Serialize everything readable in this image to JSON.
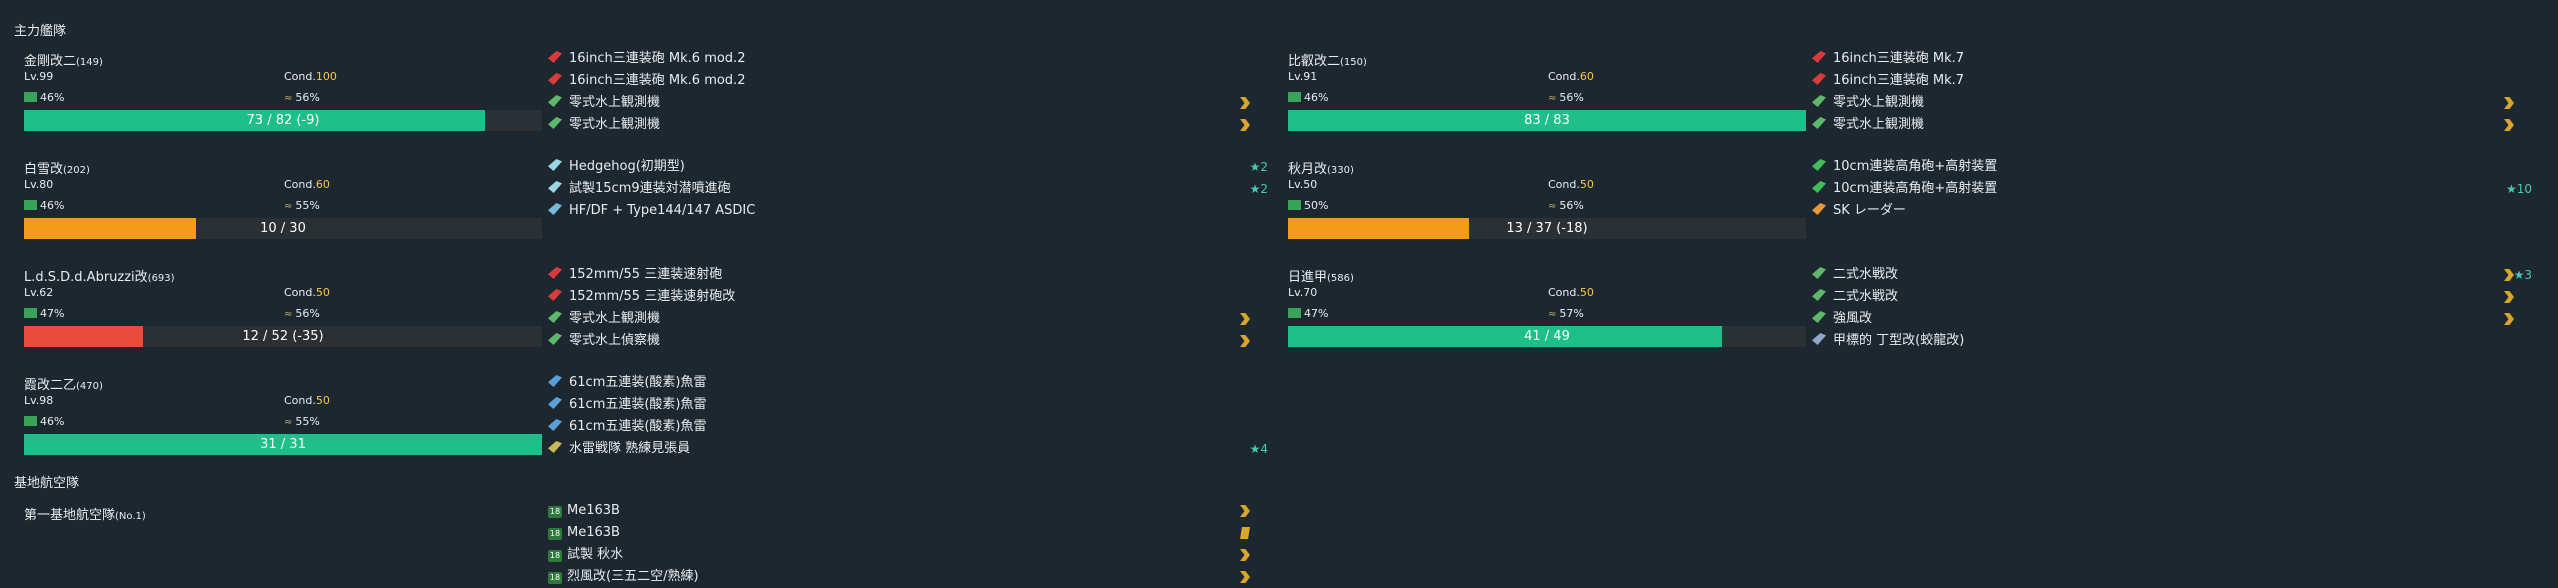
{
  "fleet_title": "主力艦隊",
  "air_title": "基地航空隊",
  "cond_label": "Cond.",
  "ships": [
    {
      "name": "金剛改二",
      "id": "(149)",
      "lv": "Lv.99",
      "cond": "100",
      "fuel": "46%",
      "ammo": "56%",
      "hp": "73 / 82 (-9)",
      "hp_frac": 0.89,
      "hp_color": "#1fbf8a",
      "equips": [
        {
          "name": "16inch三連装砲 Mk.6 mod.2",
          "icon": "main-gun-icon",
          "color": "#d83a3a",
          "prof": false,
          "star": ""
        },
        {
          "name": "16inch三連装砲 Mk.6 mod.2",
          "icon": "main-gun-icon",
          "color": "#d83a3a",
          "prof": false,
          "star": ""
        },
        {
          "name": "零式水上観測機",
          "icon": "seaplane-icon",
          "color": "#5fb86a",
          "prof": true,
          "star": ""
        },
        {
          "name": "零式水上観測機",
          "icon": "seaplane-icon",
          "color": "#5fb86a",
          "prof": true,
          "star": ""
        }
      ]
    },
    {
      "name": "白雪改",
      "id": "(202)",
      "lv": "Lv.80",
      "cond": "60",
      "fuel": "46%",
      "ammo": "55%",
      "hp": "10 / 30",
      "hp_frac": 0.333,
      "hp_color": "#f39c1a",
      "equips": [
        {
          "name": "Hedgehog(初期型)",
          "icon": "depth-charge-icon",
          "color": "#9ad6e6",
          "prof": false,
          "star": "★2"
        },
        {
          "name": "試製15cm9連装対潜噴進砲",
          "icon": "depth-charge-icon",
          "color": "#9ad6e6",
          "prof": false,
          "star": "★2"
        },
        {
          "name": "HF/DF + Type144/147 ASDIC",
          "icon": "sonar-icon",
          "color": "#7bb8d8",
          "prof": false,
          "star": ""
        }
      ]
    },
    {
      "name": "L.d.S.D.d.Abruzzi改",
      "id": "(693)",
      "lv": "Lv.62",
      "cond": "50",
      "fuel": "47%",
      "ammo": "56%",
      "hp": "12 / 52 (-35)",
      "hp_frac": 0.23,
      "hp_color": "#e74c3c",
      "equips": [
        {
          "name": "152mm/55 三連装速射砲",
          "icon": "main-gun-icon",
          "color": "#d83a3a",
          "prof": false,
          "star": ""
        },
        {
          "name": "152mm/55 三連装速射砲改",
          "icon": "main-gun-icon",
          "color": "#d83a3a",
          "prof": false,
          "star": ""
        },
        {
          "name": "零式水上観測機",
          "icon": "seaplane-icon",
          "color": "#5fb86a",
          "prof": true,
          "star": ""
        },
        {
          "name": "零式水上偵察機",
          "icon": "seaplane-icon",
          "color": "#5fb86a",
          "prof": true,
          "star": ""
        }
      ]
    },
    {
      "name": "霞改二乙",
      "id": "(470)",
      "lv": "Lv.98",
      "cond": "50",
      "fuel": "46%",
      "ammo": "55%",
      "hp": "31 / 31",
      "hp_frac": 1.0,
      "hp_color": "#1fbf8a",
      "equips": [
        {
          "name": "61cm五連装(酸素)魚雷",
          "icon": "torpedo-icon",
          "color": "#5aa0d8",
          "prof": false,
          "star": ""
        },
        {
          "name": "61cm五連装(酸素)魚雷",
          "icon": "torpedo-icon",
          "color": "#5aa0d8",
          "prof": false,
          "star": ""
        },
        {
          "name": "61cm五連装(酸素)魚雷",
          "icon": "torpedo-icon",
          "color": "#5aa0d8",
          "prof": false,
          "star": ""
        },
        {
          "name": "水雷戦隊 熟練見張員",
          "icon": "lookout-icon",
          "color": "#c8b85a",
          "prof": false,
          "star": "★4"
        }
      ]
    },
    {
      "name": "比叡改二",
      "id": "(150)",
      "lv": "Lv.91",
      "cond": "60",
      "fuel": "46%",
      "ammo": "56%",
      "hp": "83 / 83",
      "hp_frac": 1.0,
      "hp_color": "#1fbf8a",
      "equips": [
        {
          "name": "16inch三連装砲 Mk.7",
          "icon": "main-gun-icon",
          "color": "#d83a3a",
          "prof": false,
          "star": ""
        },
        {
          "name": "16inch三連装砲 Mk.7",
          "icon": "main-gun-icon",
          "color": "#d83a3a",
          "prof": false,
          "star": ""
        },
        {
          "name": "零式水上観測機",
          "icon": "seaplane-icon",
          "color": "#5fb86a",
          "prof": true,
          "star": ""
        },
        {
          "name": "零式水上観測機",
          "icon": "seaplane-icon",
          "color": "#5fb86a",
          "prof": true,
          "star": ""
        }
      ]
    },
    {
      "name": "秋月改",
      "id": "(330)",
      "lv": "Lv.50",
      "cond": "50",
      "fuel": "50%",
      "ammo": "56%",
      "hp": "13 / 37 (-18)",
      "hp_frac": 0.35,
      "hp_color": "#f39c1a",
      "equips": [
        {
          "name": "10cm連装高角砲+高射装置",
          "icon": "aa-gun-icon",
          "color": "#3fbf5a",
          "prof": false,
          "star": ""
        },
        {
          "name": "10cm連装高角砲+高射装置",
          "icon": "aa-gun-icon",
          "color": "#3fbf5a",
          "prof": false,
          "star": "★10"
        },
        {
          "name": "SK レーダー",
          "icon": "radar-icon",
          "color": "#e89a3a",
          "prof": false,
          "star": ""
        }
      ]
    },
    {
      "name": "日進甲",
      "id": "(586)",
      "lv": "Lv.70",
      "cond": "50",
      "fuel": "47%",
      "ammo": "57%",
      "hp": "41 / 49",
      "hp_frac": 0.837,
      "hp_color": "#1fbf8a",
      "equips": [
        {
          "name": "二式水戦改",
          "icon": "seaplane-fighter-icon",
          "color": "#5fb86a",
          "prof": true,
          "star": "★3"
        },
        {
          "name": "二式水戦改",
          "icon": "seaplane-fighter-icon",
          "color": "#5fb86a",
          "prof": true,
          "star": ""
        },
        {
          "name": "強風改",
          "icon": "seaplane-fighter-icon",
          "color": "#5fb86a",
          "prof": true,
          "star": ""
        },
        {
          "name": "甲標的 丁型改(蛟龍改)",
          "icon": "midget-sub-icon",
          "color": "#8fa8c8",
          "prof": false,
          "star": ""
        }
      ]
    }
  ],
  "base": {
    "name": "第一基地航空隊",
    "sub": "(No.1)",
    "planes": [
      {
        "name": "Me163B",
        "lvl": "18",
        "prof": "arrow"
      },
      {
        "name": "Me163B",
        "lvl": "18",
        "prof": "bar"
      },
      {
        "name": "試製 秋水",
        "lvl": "18",
        "prof": "arrow"
      },
      {
        "name": "烈風改(三五二空/熟練)",
        "lvl": "18",
        "prof": "arrow"
      }
    ]
  }
}
